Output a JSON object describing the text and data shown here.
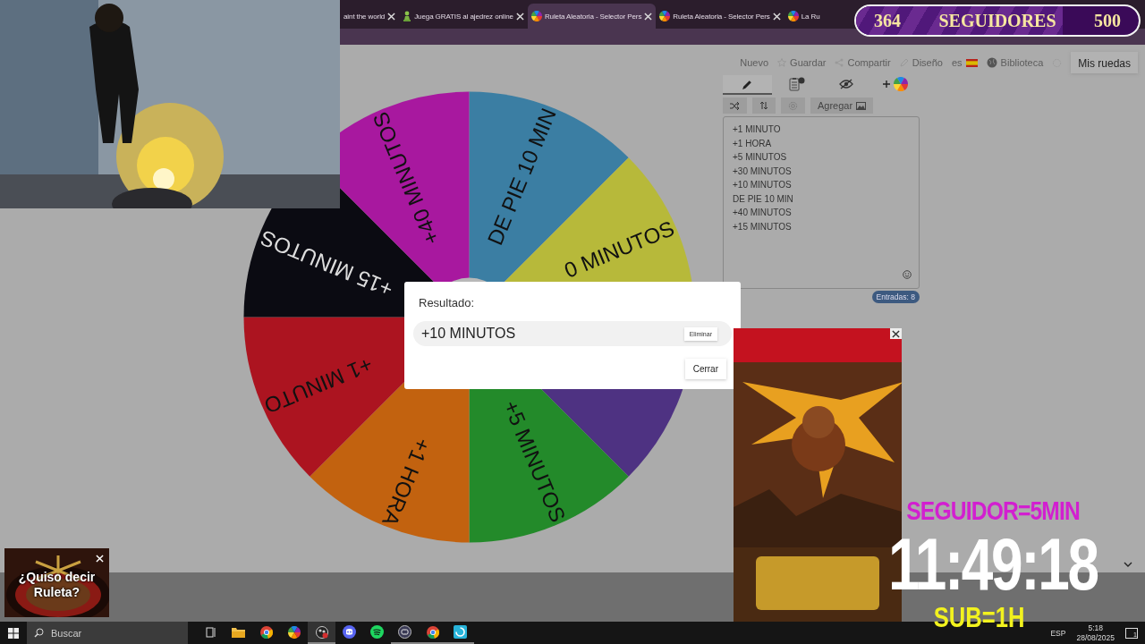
{
  "browser": {
    "tabs": [
      {
        "title": "aint the world",
        "kind": "none",
        "closable": true,
        "selected": false
      },
      {
        "title": "Juega GRATIS al ajedrez online",
        "kind": "pawn",
        "closable": true,
        "selected": false
      },
      {
        "title": "Ruleta Aleatoria - Selector Pers",
        "kind": "wheel",
        "closable": true,
        "selected": true
      },
      {
        "title": "Ruleta Aleatoria - Selector Pers",
        "kind": "wheel",
        "closable": true,
        "selected": false
      },
      {
        "title": "La Ru",
        "kind": "wheel",
        "closable": false,
        "selected": false
      }
    ]
  },
  "follower_goal": {
    "current": "364",
    "label": "SEGUIDORES",
    "goal": "500",
    "level": 0.73
  },
  "nav": [
    {
      "label": "Nuevo",
      "kind": "plain"
    },
    {
      "label": "Guardar",
      "kind": "save"
    },
    {
      "label": "Compartir",
      "kind": "share"
    },
    {
      "label": "Diseño",
      "kind": "edit"
    },
    {
      "label": "es",
      "kind": "language"
    },
    {
      "label": "Biblioteca",
      "kind": "library"
    }
  ],
  "my_wheels_button": "Mis ruedas",
  "editor": {
    "tabs": [
      {
        "kind": "edit",
        "selected": true
      },
      {
        "kind": "results",
        "selected": false
      },
      {
        "kind": "hide",
        "selected": false
      },
      {
        "kind": "add-wheel",
        "selected": false
      }
    ],
    "tools": [
      {
        "kind": "shuffle"
      },
      {
        "kind": "sort"
      },
      {
        "kind": "settings"
      }
    ],
    "add_button": "Agregar",
    "entries": [
      "+1 MINUTO",
      "+1 HORA",
      "+5 MINUTOS",
      "+30 MINUTOS",
      "+10 MINUTOS",
      "DE PIE 10 MIN",
      "+40 MINUTOS",
      "+15 MINUTOS"
    ],
    "count": "Entradas: 8"
  },
  "wheel": {
    "segments": [
      {
        "label": "DE PIE 10 MIN",
        "color": "#3b7ea3"
      },
      {
        "label": "0 MINUTOS",
        "color": "#b7b93a"
      },
      {
        "color": "#4e3282"
      },
      {
        "label": "+5 MINUTOS",
        "color": "#238a2a"
      },
      {
        "label": "+1 HORA",
        "color": "#c2620f"
      },
      {
        "label": "+1 MINUTO",
        "color": "#ac1420"
      },
      {
        "label": "+15 MINUTOS",
        "color": "#0b0b12"
      },
      {
        "label": "+40 MINUTOS",
        "color": "#a8189f"
      }
    ]
  },
  "dialog": {
    "title": "Resultado:",
    "result": "+10 MINUTOS",
    "remove_button": "Eliminar",
    "close_button": "Cerrar"
  },
  "ad_small": {
    "text": "¿Quiso decir Ruleta?"
  },
  "timer": {
    "rule_top": "SEGUIDOR=5MIN",
    "time": "11:49:18",
    "rule_bottom": "SUB=1H"
  },
  "taskbar": {
    "search_placeholder": "Buscar",
    "apps": [
      {
        "kind": "task-view",
        "running": false,
        "selected": false
      },
      {
        "kind": "folder",
        "running": false,
        "selected": false
      },
      {
        "kind": "chrome",
        "running": false,
        "selected": false
      },
      {
        "kind": "photos",
        "running": false,
        "selected": false
      },
      {
        "kind": "obs",
        "running": true,
        "selected": true
      },
      {
        "kind": "discord",
        "running": false,
        "selected": false
      },
      {
        "kind": "spotify",
        "running": false,
        "selected": false
      },
      {
        "kind": "capture",
        "running": true,
        "selected": false
      },
      {
        "kind": "chrome",
        "running": true,
        "selected": false
      },
      {
        "kind": "app",
        "running": true,
        "selected": false
      }
    ],
    "language": "ESP",
    "time": "5:18",
    "date": "28/08/2025",
    "notifications": "1"
  }
}
